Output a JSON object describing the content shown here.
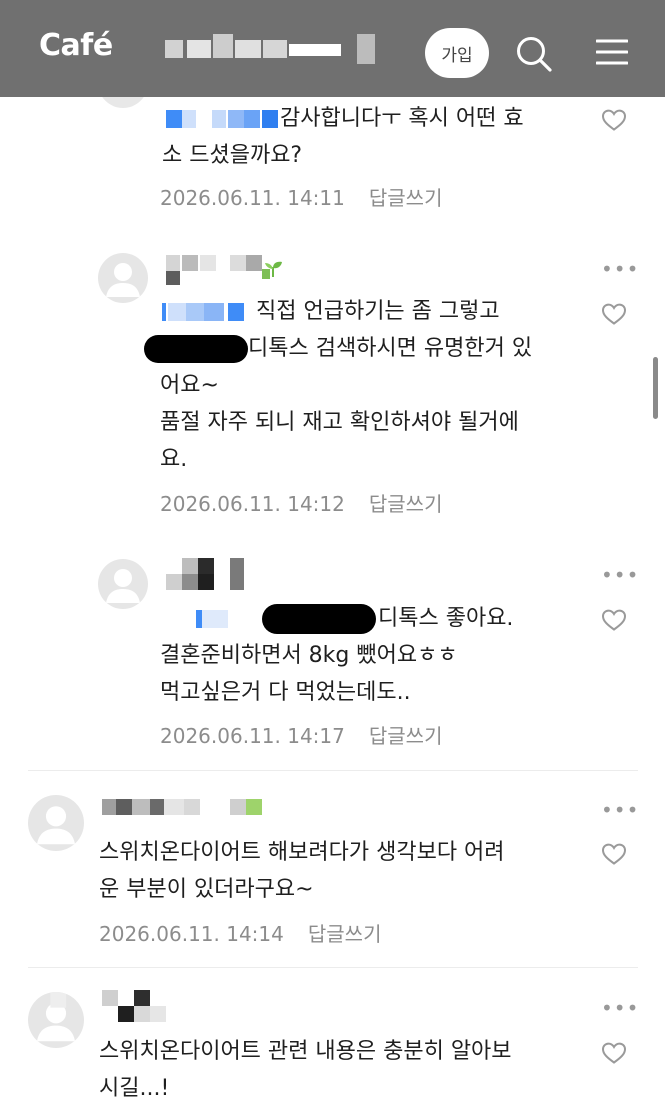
{
  "header": {
    "logo": "Café",
    "join_label": "가입",
    "search_icon": "search-icon",
    "menu_icon": "hamburger-menu-icon",
    "background": "#707070"
  },
  "comments": [
    {
      "lines": [
        "감사합니다ㅜ 혹시 어떤 효",
        "소 드셨을까요?"
      ],
      "date": "2026.06.11. 14:11",
      "reply_label": "답글쓰기"
    },
    {
      "lines": [
        "직접 언급하기는 좀 그렇고",
        "디톡스 검색하시면 유명한거 있",
        "어요~",
        "품절 자주 되니 재고 확인하셔야 될거에",
        "요."
      ],
      "date": "2026.06.11. 14:12",
      "reply_label": "답글쓰기"
    },
    {
      "lines": [
        "디톡스 좋아요.",
        "결혼준비하면서 8kg 뺐어요ㅎㅎ",
        "먹고싶은거 다 먹었는데도.."
      ],
      "date": "2026.06.11. 14:17",
      "reply_label": "답글쓰기"
    },
    {
      "lines": [
        "스위치온다이어트 해보려다가 생각보다 어려",
        "운 부분이 있더라구요~"
      ],
      "date": "2026.06.11. 14:14",
      "reply_label": "답글쓰기"
    },
    {
      "lines": [
        "스위치온다이어트 관련 내용은 충분히 알아보",
        "시길...!"
      ]
    }
  ],
  "more_symbol": "•••",
  "colors": {
    "mention": "#3f8cf7",
    "meta_text": "#8c8c8c",
    "heart": "#9a9a9a"
  }
}
